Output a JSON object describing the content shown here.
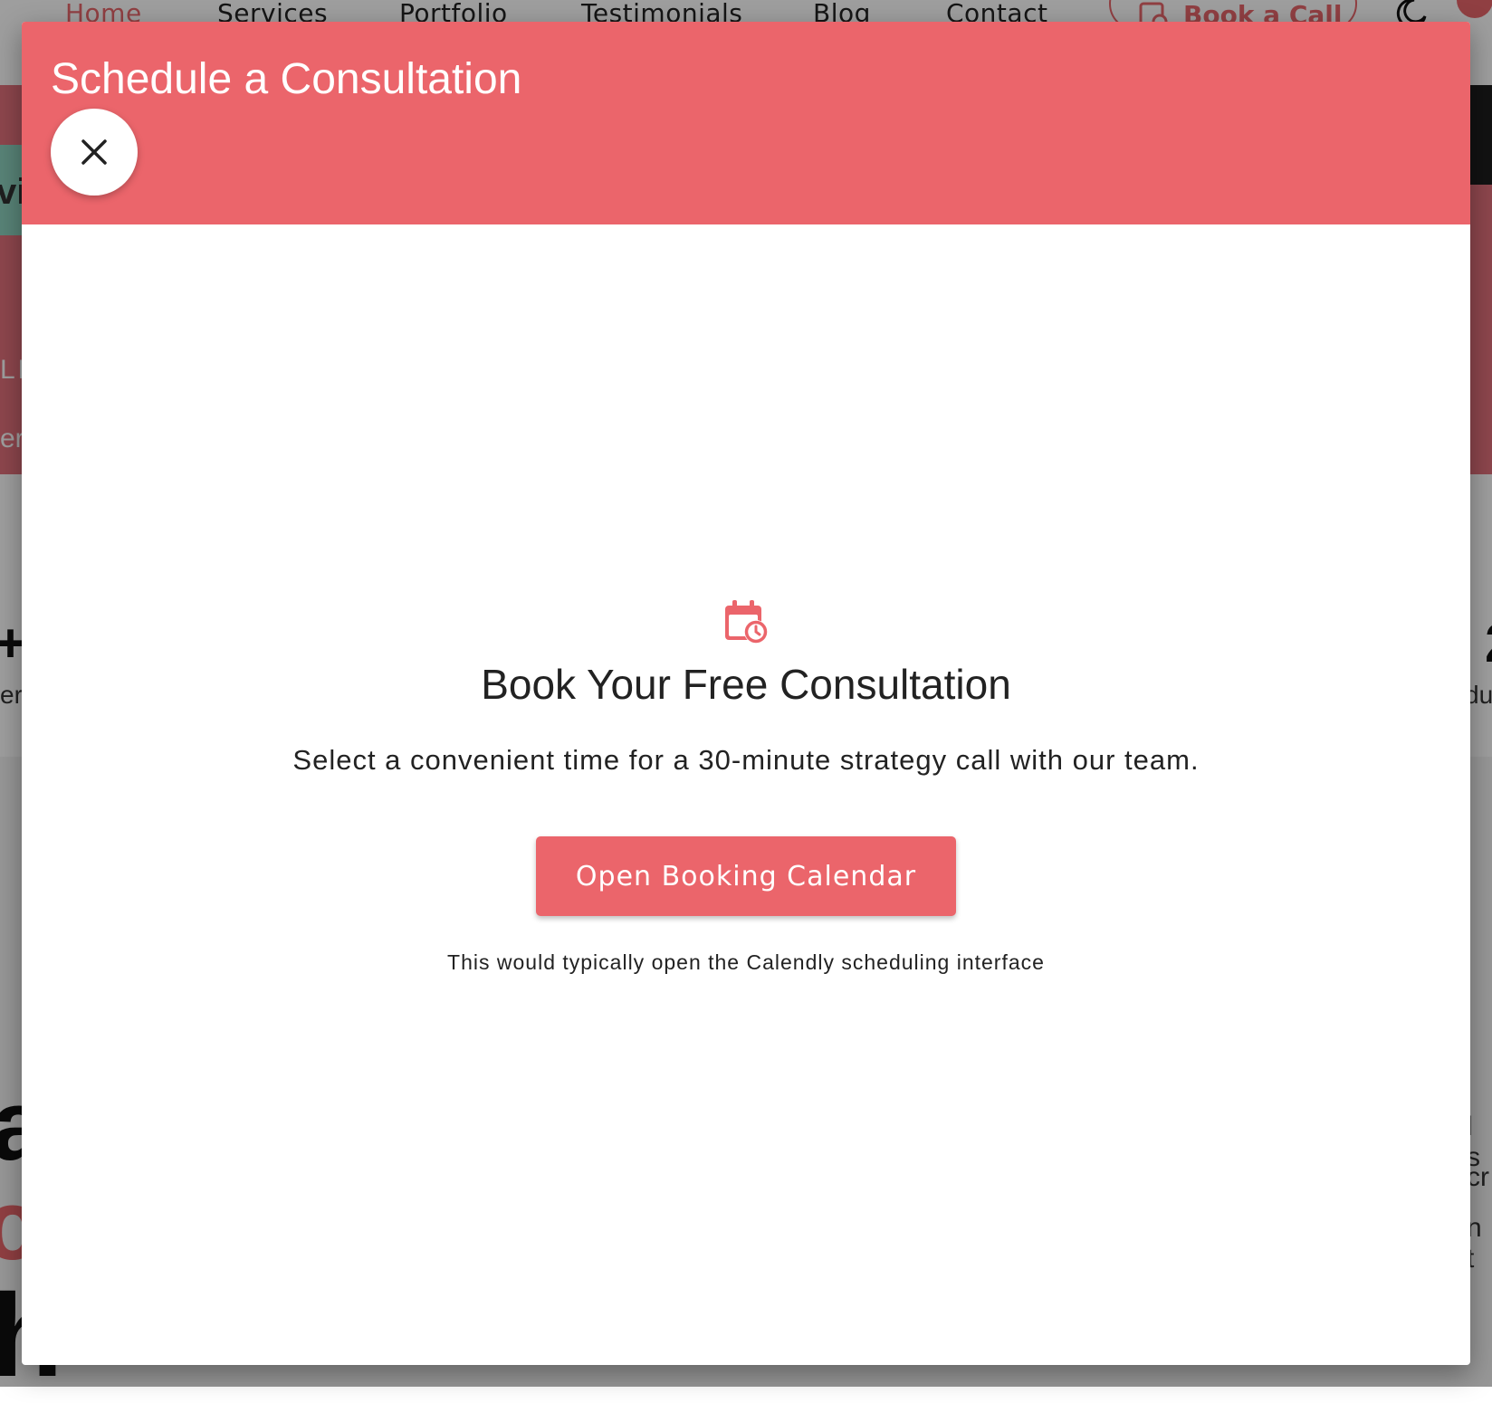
{
  "background": {
    "nav": {
      "links": [
        "Home",
        "Services",
        "Portfolio",
        "Testimonials",
        "Blog",
        "Contact"
      ],
      "book_label": "Book a Call"
    },
    "hero": {
      "pill_text": "vi",
      "text1": "LE",
      "text2": "er"
    },
    "stats": {
      "left_value": "+",
      "left_label": "er",
      "right_value": "2",
      "right_label": "du"
    },
    "fragments": {
      "a": "a",
      "c": "c",
      "h": "h",
      "r1": "l s",
      "r2": "cr",
      "r3": "n t"
    }
  },
  "modal": {
    "title": "Schedule a Consultation",
    "close_icon": "close-icon",
    "body": {
      "icon": "calendar-clock-icon",
      "heading": "Book Your Free Consultation",
      "subheading": "Select a convenient time for a 30-minute strategy call with our team.",
      "button_label": "Open Booking Calendar",
      "note": "This would typically open the Calendly scheduling interface"
    }
  },
  "colors": {
    "accent": "#eb656b",
    "overlay": "rgba(0,0,0,0.38)",
    "text": "#222222"
  }
}
